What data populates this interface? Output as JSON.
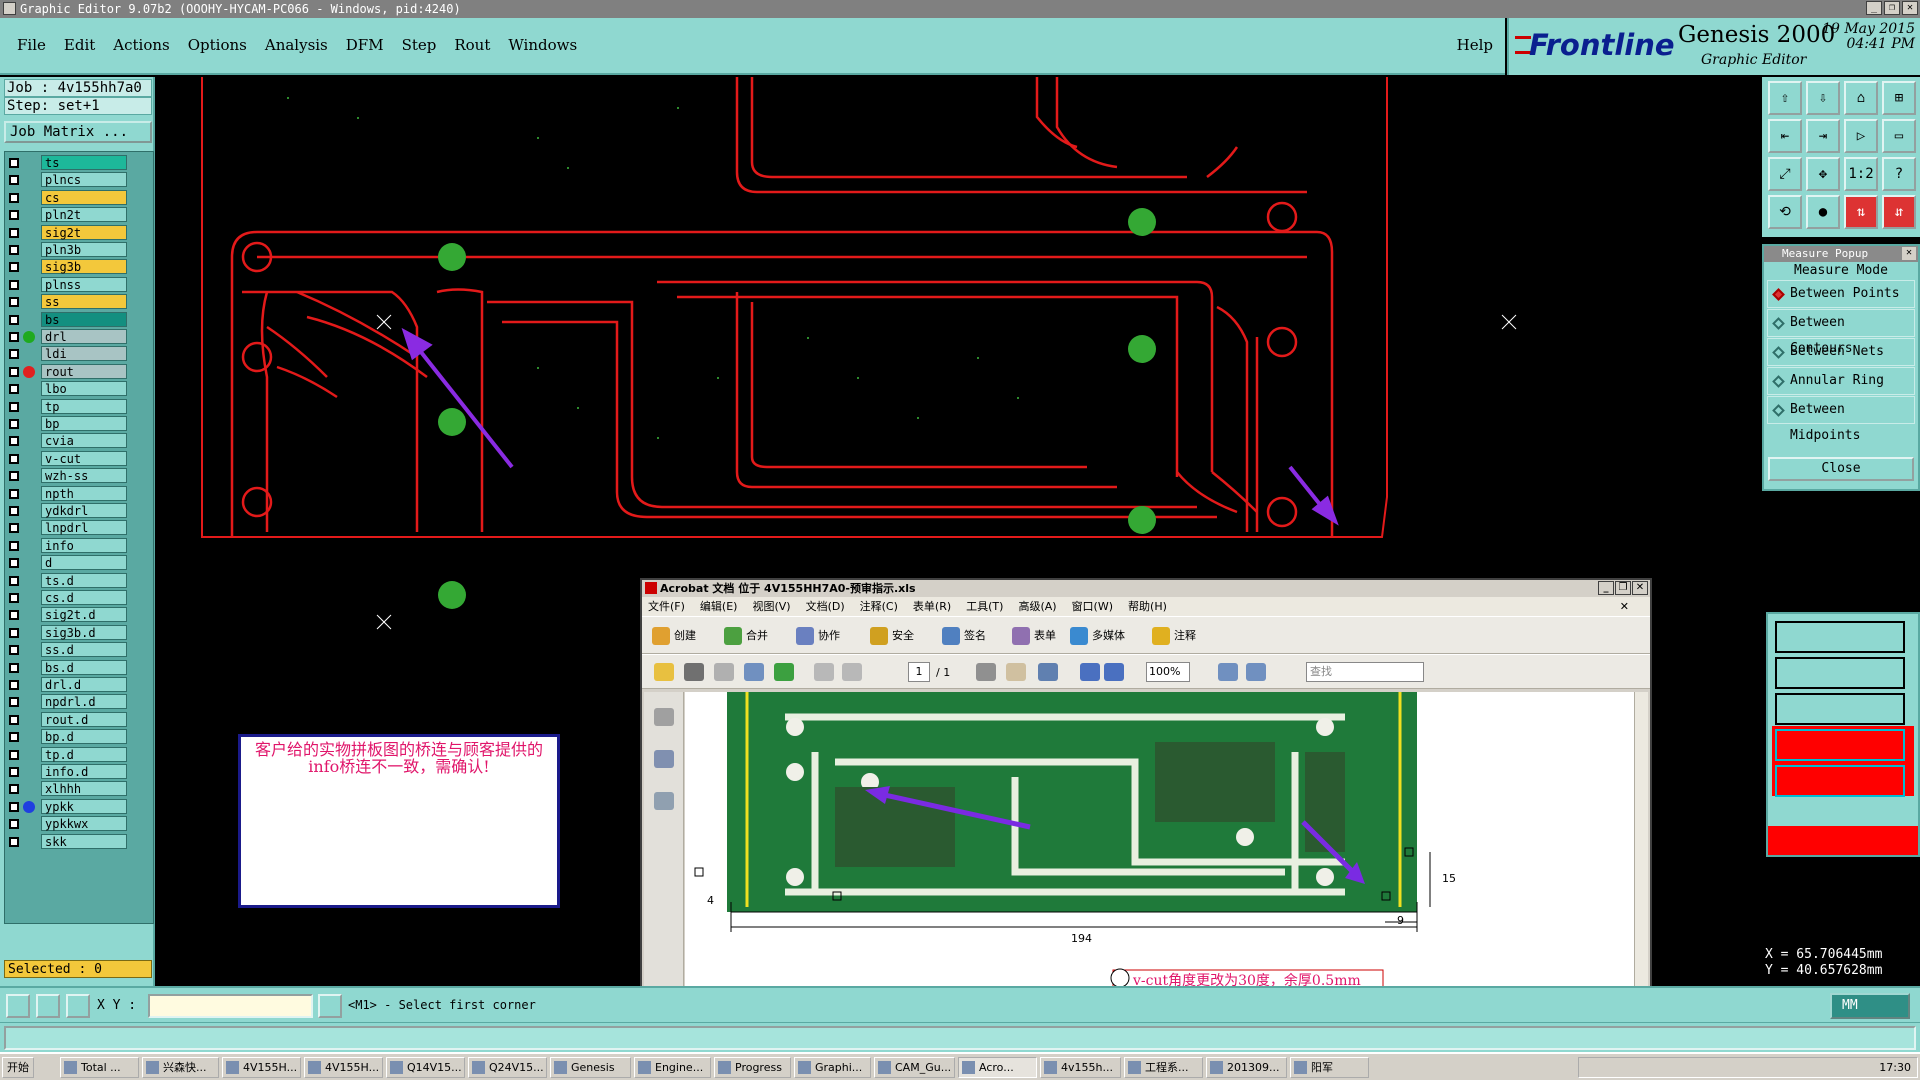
{
  "window": {
    "title": "Graphic Editor 9.07b2 (OOOHY-HYCAM-PC066 - Windows, pid:4240)"
  },
  "menu": [
    "File",
    "Edit",
    "Actions",
    "Options",
    "Analysis",
    "DFM",
    "Step",
    "Rout",
    "Windows"
  ],
  "help_label": "Help",
  "brand": {
    "logo": "Frontline",
    "product": "Genesis 2000",
    "subtitle": "Graphic Editor",
    "date": "19 May 2015",
    "time": "04:41 PM"
  },
  "job": {
    "job_line": "Job : 4v155hh7a0",
    "step_line": "Step: set+1",
    "matrix_label": "Job Matrix ..."
  },
  "layers": [
    {
      "name": "ts",
      "color": "green",
      "dot": ""
    },
    {
      "name": "plncs",
      "color": "",
      "dot": ""
    },
    {
      "name": "cs",
      "color": "yellow",
      "dot": ""
    },
    {
      "name": "pln2t",
      "color": "",
      "dot": ""
    },
    {
      "name": "sig2t",
      "color": "yellow",
      "dot": ""
    },
    {
      "name": "pln3b",
      "color": "",
      "dot": ""
    },
    {
      "name": "sig3b",
      "color": "yellow",
      "dot": ""
    },
    {
      "name": "plnss",
      "color": "",
      "dot": ""
    },
    {
      "name": "ss",
      "color": "yellow",
      "dot": ""
    },
    {
      "name": "bs",
      "color": "teal",
      "dot": ""
    },
    {
      "name": "drl",
      "color": "gray",
      "dot": "#1faa1f"
    },
    {
      "name": "ldi",
      "color": "gray",
      "dot": ""
    },
    {
      "name": "rout",
      "color": "gray",
      "dot": "#e02020"
    },
    {
      "name": "lbo",
      "color": "",
      "dot": ""
    },
    {
      "name": "tp",
      "color": "",
      "dot": ""
    },
    {
      "name": "bp",
      "color": "",
      "dot": ""
    },
    {
      "name": "cvia",
      "color": "",
      "dot": ""
    },
    {
      "name": "v-cut",
      "color": "",
      "dot": ""
    },
    {
      "name": "wzh-ss",
      "color": "",
      "dot": ""
    },
    {
      "name": "npth",
      "color": "",
      "dot": ""
    },
    {
      "name": "ydkdrl",
      "color": "",
      "dot": ""
    },
    {
      "name": "lnpdrl",
      "color": "",
      "dot": ""
    },
    {
      "name": "info",
      "color": "",
      "dot": ""
    },
    {
      "name": "d",
      "color": "",
      "dot": ""
    },
    {
      "name": "ts.d",
      "color": "",
      "dot": ""
    },
    {
      "name": "cs.d",
      "color": "",
      "dot": ""
    },
    {
      "name": "sig2t.d",
      "color": "",
      "dot": ""
    },
    {
      "name": "sig3b.d",
      "color": "",
      "dot": ""
    },
    {
      "name": "ss.d",
      "color": "",
      "dot": ""
    },
    {
      "name": "bs.d",
      "color": "",
      "dot": ""
    },
    {
      "name": "drl.d",
      "color": "",
      "dot": ""
    },
    {
      "name": "npdrl.d",
      "color": "",
      "dot": ""
    },
    {
      "name": "rout.d",
      "color": "",
      "dot": ""
    },
    {
      "name": "bp.d",
      "color": "",
      "dot": ""
    },
    {
      "name": "tp.d",
      "color": "",
      "dot": ""
    },
    {
      "name": "info.d",
      "color": "",
      "dot": ""
    },
    {
      "name": "xlhhh",
      "color": "",
      "dot": ""
    },
    {
      "name": "ypkk",
      "color": "",
      "dot": "#1f3fe0"
    },
    {
      "name": "ypkkwx",
      "color": "",
      "dot": ""
    },
    {
      "name": "skk",
      "color": "",
      "dot": ""
    }
  ],
  "selected_label": "Selected : 0",
  "measure": {
    "title": "Measure Popup",
    "mode_label": "Measure Mode",
    "options": [
      "Between Points",
      "Between Contours",
      "Between Nets",
      "Annular Ring",
      "Between Midpoints"
    ],
    "active": 0,
    "close_label": "Close"
  },
  "tools": [
    "⇧",
    "⇩",
    "⌂",
    "⊞",
    "⇤",
    "⇥",
    "▷",
    "▭",
    "⤢",
    "✥",
    "1:2",
    "?",
    "⟲",
    "●",
    "⇅",
    "⇵"
  ],
  "coords": {
    "x": "X = 65.706445mm",
    "y": "Y = 40.657628mm"
  },
  "bottom": {
    "xy_label": "X Y :",
    "prompt": "<M1> - Select first corner",
    "units": "MM"
  },
  "note": {
    "text": "客户给的实物拼板图的桥连与顾客提供的info桥连不一致，需确认!"
  },
  "acrobat": {
    "title": "Acrobat 文档 位于 4V155HH7A0-预审指示.xls",
    "menu": [
      "文件(F)",
      "编辑(E)",
      "视图(V)",
      "文档(D)",
      "注释(C)",
      "表单(R)",
      "工具(T)",
      "高级(A)",
      "窗口(W)",
      "帮助(H)"
    ],
    "toolbar": [
      "创建",
      "合并",
      "协作",
      "安全",
      "签名",
      "表单",
      "多媒体",
      "注释"
    ],
    "page": "1",
    "page_total": "/ 1",
    "zoom": "100%",
    "find_placeholder": "查找",
    "dims": {
      "width": "194",
      "height": "15",
      "edge": "9",
      "left": "4"
    },
    "footer_text": "v-cut角度更改为30度，余厚0.5mm"
  },
  "taskbar": {
    "start": "开始",
    "items": [
      "Total ...",
      "兴森快...",
      "4V155H...",
      "4V155H...",
      "Q14V15...",
      "Q24V15...",
      "Genesis",
      "Engine...",
      "Progress",
      "Graphi...",
      "CAM_Gu...",
      "Acro...",
      "4v155h...",
      "工程系...",
      "201309...",
      "阳军"
    ],
    "active_index": 11,
    "clock": "17:30"
  }
}
